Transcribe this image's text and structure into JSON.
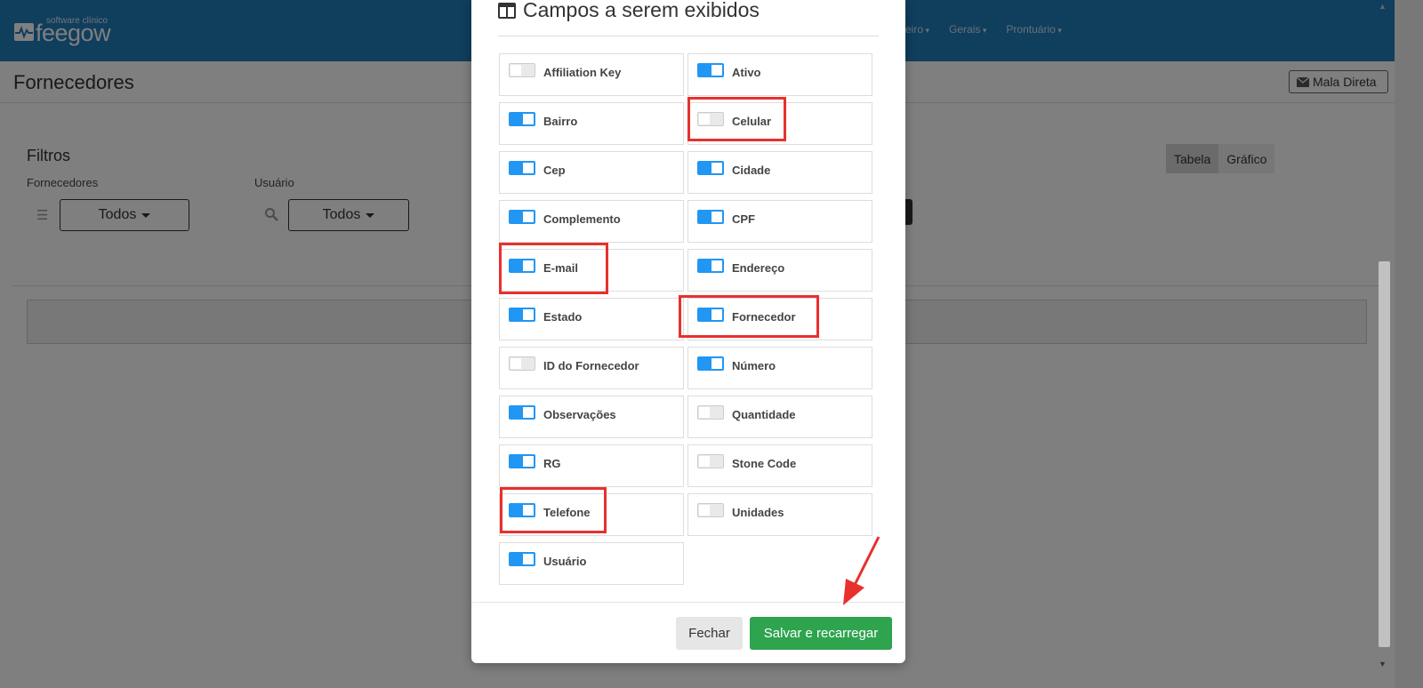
{
  "navbar": {
    "logo_small": "software clínico",
    "logo_text": "feegow",
    "menu": [
      "eiro",
      "Gerais",
      "Prontuário"
    ]
  },
  "page": {
    "title": "Fornecedores",
    "mala_direta": "Mala Direta"
  },
  "filters": {
    "title": "Filtros",
    "fornecedores_label": "Fornecedores",
    "fornecedores_value": "Todos",
    "usuario_label": "Usuário",
    "usuario_value": "Todos"
  },
  "view_toggle": {
    "tabela": "Tabela",
    "grafico": "Gráfico"
  },
  "modal": {
    "title": "Campos a serem exibidos",
    "fields": [
      {
        "label": "Affiliation Key",
        "on": false
      },
      {
        "label": "Ativo",
        "on": true
      },
      {
        "label": "Bairro",
        "on": true
      },
      {
        "label": "Celular",
        "on": false
      },
      {
        "label": "Cep",
        "on": true
      },
      {
        "label": "Cidade",
        "on": true
      },
      {
        "label": "Complemento",
        "on": true
      },
      {
        "label": "CPF",
        "on": true
      },
      {
        "label": "E-mail",
        "on": true
      },
      {
        "label": "Endereço",
        "on": true
      },
      {
        "label": "Estado",
        "on": true
      },
      {
        "label": "Fornecedor",
        "on": true
      },
      {
        "label": "ID do Fornecedor",
        "on": false
      },
      {
        "label": "Número",
        "on": true
      },
      {
        "label": "Observações",
        "on": true
      },
      {
        "label": "Quantidade",
        "on": false
      },
      {
        "label": "RG",
        "on": true
      },
      {
        "label": "Stone Code",
        "on": false
      },
      {
        "label": "Telefone",
        "on": true
      },
      {
        "label": "Unidades",
        "on": false
      },
      {
        "label": "Usuário",
        "on": true
      }
    ],
    "fechar": "Fechar",
    "salvar": "Salvar e recarregar"
  },
  "colors": {
    "navbar": "#217dbb",
    "toggle_on": "#2196f3",
    "save_button": "#2ea44f",
    "annotation": "#e8302d"
  }
}
